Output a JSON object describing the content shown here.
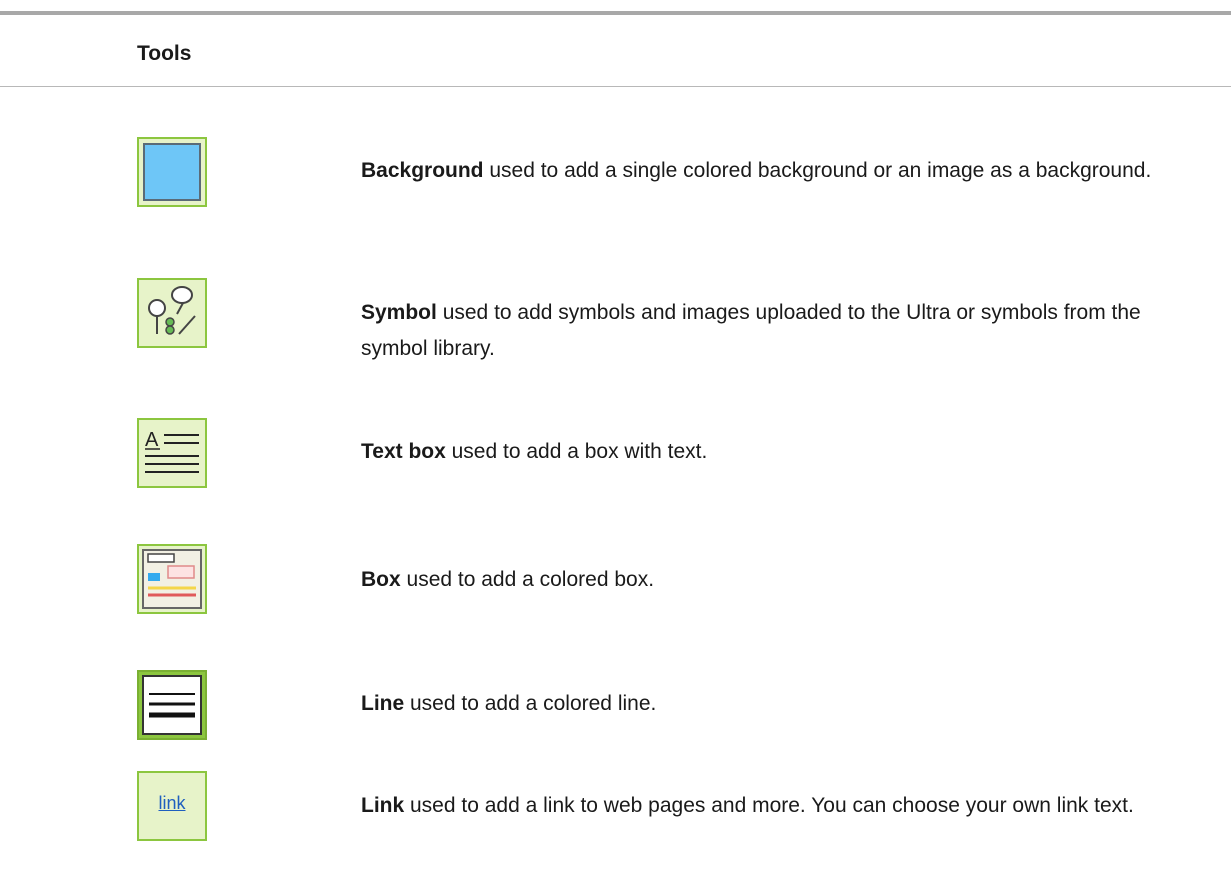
{
  "header": {
    "title": "Tools"
  },
  "tools": [
    {
      "name": "Background",
      "description": " used to add a single colored background or an image as a background.",
      "icon": "background-icon"
    },
    {
      "name": "Symbol",
      "description": " used to add symbols and images uploaded to the Ultra or symbols from the symbol library.",
      "icon": "symbol-icon"
    },
    {
      "name": "Text box",
      "description": " used to add a box with text.",
      "icon": "text-box-icon"
    },
    {
      "name": "Box",
      "description": " used to add a colored box.",
      "icon": "box-icon"
    },
    {
      "name": "Line",
      "description": " used to add a colored line.",
      "icon": "line-icon"
    },
    {
      "name": "Link",
      "description": " used to add a link to web pages and more. You can choose your own link text.",
      "icon": "link-icon",
      "icon_text": "link"
    }
  ],
  "colors": {
    "icon_border": "#8cc63f",
    "icon_fill": "#e7f3c9",
    "background_swatch": "#6ec6f7",
    "link_text": "#1f5fbf"
  }
}
